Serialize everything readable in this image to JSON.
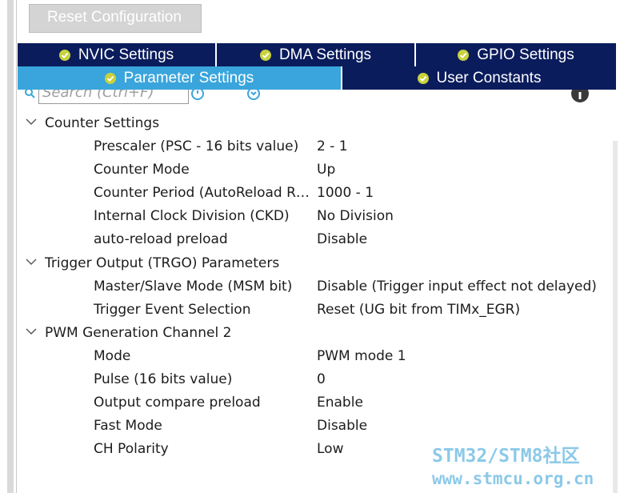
{
  "toolbar": {
    "reset_label": "Reset Configuration"
  },
  "tabs": {
    "row1": [
      {
        "label": "NVIC Settings",
        "active": false
      },
      {
        "label": "DMA Settings",
        "active": false
      },
      {
        "label": "GPIO Settings",
        "active": false
      }
    ],
    "row2": [
      {
        "label": "Parameter Settings",
        "active": true
      },
      {
        "label": "User Constants",
        "active": false
      }
    ]
  },
  "search": {
    "placeholder": "Search (Ctrl+F)"
  },
  "groups": [
    {
      "label": "Counter Settings",
      "params": [
        {
          "name": "Prescaler (PSC - 16 bits value)",
          "value": "2 - 1"
        },
        {
          "name": "Counter Mode",
          "value": "Up"
        },
        {
          "name": "Counter Period (AutoReload R…",
          "value": "1000 - 1"
        },
        {
          "name": "Internal Clock Division (CKD)",
          "value": "No Division"
        },
        {
          "name": "auto-reload preload",
          "value": "Disable"
        }
      ]
    },
    {
      "label": "Trigger Output (TRGO) Parameters",
      "params": [
        {
          "name": "Master/Slave Mode (MSM bit)",
          "value": "Disable (Trigger input effect not delayed)"
        },
        {
          "name": "Trigger Event Selection",
          "value": "Reset (UG bit from TIMx_EGR)"
        }
      ]
    },
    {
      "label": "PWM Generation Channel 2",
      "params": [
        {
          "name": "Mode",
          "value": "PWM mode 1"
        },
        {
          "name": "Pulse (16 bits value)",
          "value": "0"
        },
        {
          "name": "Output compare preload",
          "value": "Enable"
        },
        {
          "name": "Fast Mode",
          "value": "Disable"
        },
        {
          "name": "CH Polarity",
          "value": "Low"
        }
      ]
    }
  ],
  "watermark": {
    "line1": "STM32/STM8社区",
    "line2": "www.stmcu.org.cn"
  },
  "colors": {
    "tab_inactive": "#0a1c5c",
    "tab_active": "#3aa5dc",
    "check_green": "#c8d23c",
    "watermark": "#7fc4e6"
  }
}
